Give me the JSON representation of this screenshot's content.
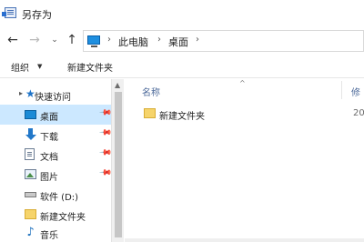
{
  "window": {
    "title": "另存为"
  },
  "nav": {
    "back": "←",
    "forward": "→",
    "recent": "⌄",
    "up": "↑"
  },
  "address": {
    "crumbs": [
      "此电脑",
      "桌面"
    ],
    "separator": "›"
  },
  "toolbar": {
    "organize_label": "组织",
    "organize_arrow": "▼",
    "new_folder_label": "新建文件夹"
  },
  "sidebar": {
    "quick_access_label": "快速访问",
    "items": [
      {
        "label": "桌面",
        "icon": "desktop-icon",
        "pinned": true,
        "selected": true
      },
      {
        "label": "下载",
        "icon": "download-icon",
        "pinned": true,
        "selected": false
      },
      {
        "label": "文档",
        "icon": "document-icon",
        "pinned": true,
        "selected": false
      },
      {
        "label": "图片",
        "icon": "picture-icon",
        "pinned": true,
        "selected": false
      },
      {
        "label": "软件 (D:)",
        "icon": "drive-icon",
        "pinned": false,
        "selected": false
      },
      {
        "label": "新建文件夹",
        "icon": "folder-icon",
        "pinned": false,
        "selected": false
      },
      {
        "label": "音乐",
        "icon": "music-icon",
        "pinned": false,
        "selected": false
      }
    ],
    "selected_color": "#cce8ff"
  },
  "content": {
    "columns": {
      "name": "名称",
      "modified": "修"
    },
    "files": [
      {
        "name": "新建文件夹",
        "date": "20"
      }
    ]
  }
}
